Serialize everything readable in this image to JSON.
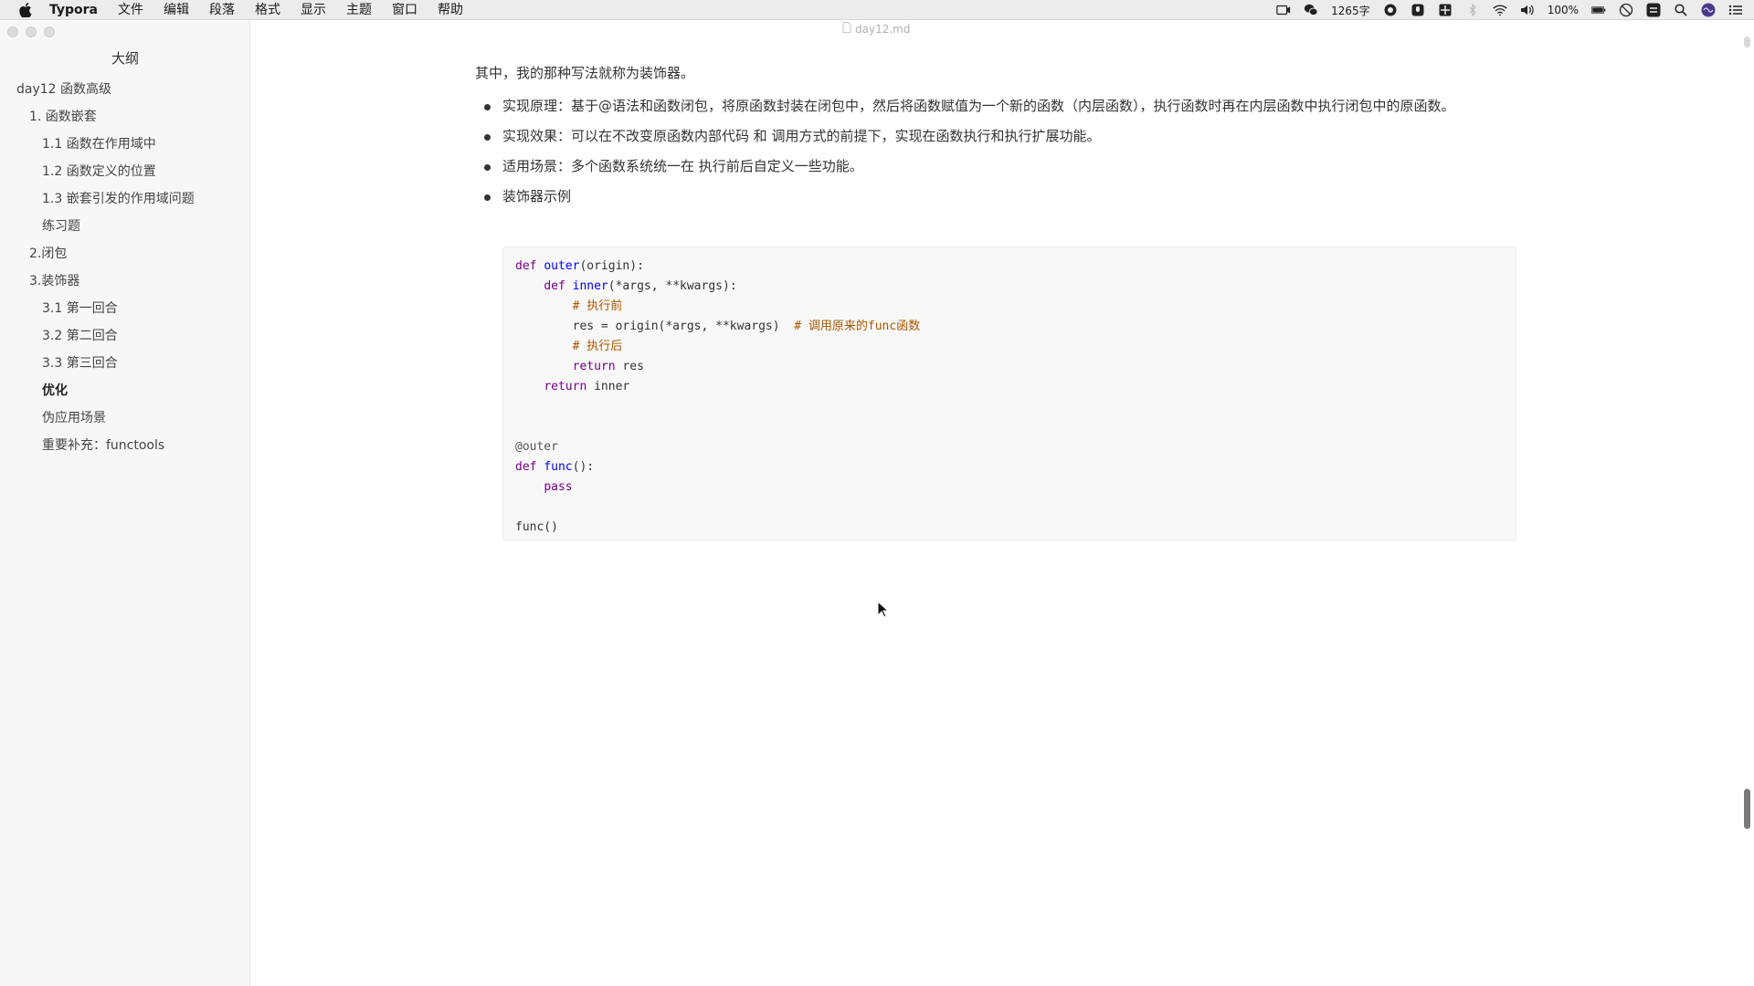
{
  "menubar": {
    "app_name": "Typora",
    "items": [
      "文件",
      "编辑",
      "段落",
      "格式",
      "显示",
      "主题",
      "窗口",
      "帮助"
    ],
    "word_count": "1265字",
    "battery": "100%"
  },
  "sidebar": {
    "title": "大纲",
    "items": [
      {
        "label": "day12 函数高级",
        "level": 1
      },
      {
        "label": "1. 函数嵌套",
        "level": 2
      },
      {
        "label": "1.1 函数在作用域中",
        "level": 3
      },
      {
        "label": "1.2 函数定义的位置",
        "level": 3
      },
      {
        "label": "1.3 嵌套引发的作用域问题",
        "level": 3
      },
      {
        "label": "练习题",
        "level": 3
      },
      {
        "label": "2.闭包",
        "level": 2
      },
      {
        "label": "3.装饰器",
        "level": 2
      },
      {
        "label": "3.1 第一回合",
        "level": 3
      },
      {
        "label": "3.2 第二回合",
        "level": 3
      },
      {
        "label": "3.3 第三回合",
        "level": 3
      },
      {
        "label": "优化",
        "level": 3,
        "active": true
      },
      {
        "label": "伪应用场景",
        "level": 3
      },
      {
        "label": "重要补充：functools",
        "level": 3
      }
    ]
  },
  "document": {
    "filename": "day12.md",
    "intro": "其中，我的那种写法就称为装饰器。",
    "bullets": [
      "实现原理：基于@语法和函数闭包，将原函数封装在闭包中，然后将函数赋值为一个新的函数（内层函数），执行函数时再在内层函数中执行闭包中的原函数。",
      "实现效果：可以在不改变原函数内部代码 和 调用方式的前提下，实现在函数执行和执行扩展功能。",
      "适用场景：多个函数系统统一在 执行前后自定义一些功能。",
      "装饰器示例"
    ],
    "code": {
      "l1_kw": "def",
      "l1_fn": "outer",
      "l1_rest": "(origin):",
      "l2_indent": "    ",
      "l2_kw": "def",
      "l2_fn": "inner",
      "l2_rest": "(*args, **kwargs):",
      "l3": "        # 执行前",
      "l4_code": "        res = origin(*args, **kwargs)  ",
      "l4_comment": "# 调用原来的func函数",
      "l5": "        # 执行后",
      "l6_indent": "        ",
      "l6_kw": "return",
      "l6_rest": " res",
      "l7_indent": "    ",
      "l7_kw": "return",
      "l7_rest": " inner",
      "l10": "@outer",
      "l11_kw": "def",
      "l11_fn": "func",
      "l11_rest": "():",
      "l12_indent": "    ",
      "l12_kw": "pass",
      "l14": "func()"
    }
  },
  "colors": {
    "keyword": "#770088",
    "function": "#0000ff",
    "comment": "#aa5500"
  }
}
